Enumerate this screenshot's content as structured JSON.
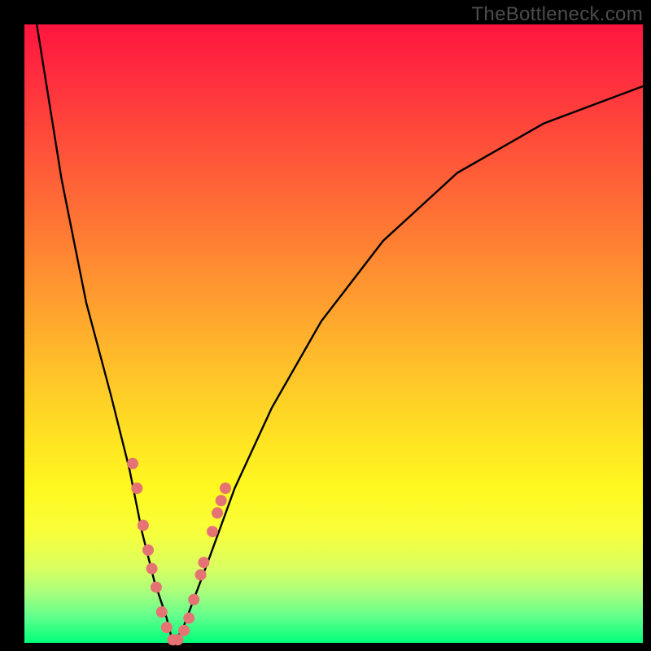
{
  "watermark": "TheBottleneck.com",
  "chart_data": {
    "type": "line",
    "title": "",
    "xlabel": "",
    "ylabel": "",
    "xlim": [
      0,
      100
    ],
    "ylim": [
      0,
      100
    ],
    "gradient_stops": [
      {
        "pos": 0,
        "color": "#ff153e"
      },
      {
        "pos": 18,
        "color": "#ff4b3a"
      },
      {
        "pos": 43,
        "color": "#ff9830"
      },
      {
        "pos": 67,
        "color": "#ffe323"
      },
      {
        "pos": 82,
        "color": "#f8ff3a"
      },
      {
        "pos": 96,
        "color": "#5cff8c"
      },
      {
        "pos": 100,
        "color": "#00ff7a"
      }
    ],
    "series": [
      {
        "name": "bottleneck-curve",
        "description": "V-shaped curve with minimum near x≈24, y≈0; left branch steep to y=100 at x≈2, right branch shallower rising to y≈90 at x=100",
        "x": [
          2,
          6,
          10,
          14,
          17,
          19,
          21,
          23,
          24,
          25.5,
          27,
          30,
          34,
          40,
          48,
          58,
          70,
          84,
          100
        ],
        "values": [
          100,
          75,
          55,
          40,
          28,
          18,
          10,
          4,
          0,
          2,
          6,
          14,
          25,
          38,
          52,
          65,
          76,
          84,
          90
        ]
      }
    ],
    "markers": {
      "name": "data-points",
      "color": "#e57373",
      "radius": 7,
      "points": [
        {
          "x": 17.5,
          "y": 29
        },
        {
          "x": 18.2,
          "y": 25
        },
        {
          "x": 19.2,
          "y": 19
        },
        {
          "x": 20.0,
          "y": 15
        },
        {
          "x": 20.6,
          "y": 12
        },
        {
          "x": 21.3,
          "y": 9
        },
        {
          "x": 22.2,
          "y": 5
        },
        {
          "x": 23.0,
          "y": 2.5
        },
        {
          "x": 24.0,
          "y": 0.5
        },
        {
          "x": 24.8,
          "y": 0.5
        },
        {
          "x": 25.8,
          "y": 2
        },
        {
          "x": 26.6,
          "y": 4
        },
        {
          "x": 27.4,
          "y": 7
        },
        {
          "x": 28.5,
          "y": 11
        },
        {
          "x": 29.0,
          "y": 13
        },
        {
          "x": 30.4,
          "y": 18
        },
        {
          "x": 31.2,
          "y": 21
        },
        {
          "x": 31.8,
          "y": 23
        },
        {
          "x": 32.5,
          "y": 25
        }
      ]
    }
  }
}
